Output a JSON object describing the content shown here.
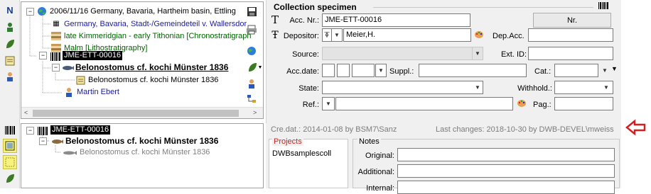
{
  "tree": {
    "root": "2006/11/16 Germany, Bavaria, Hartheim basin, Ettling",
    "locality": "Germany, Bavaria, Stadt-/Gemeindeteil v. Wallersdor",
    "strat1": "late Kimmeridgian - early Tithonian [Chronostratigraph",
    "strat2": "Malm [Lithostratigraphy]",
    "specimen": "JME-ETT-00016",
    "taxon": "Belonostomus cf. kochi Münster 1836",
    "identification": "Belonostomus cf. kochi Münster 1836",
    "collector": "Martin Ebert"
  },
  "tree2": {
    "specimen": "JME-ETT-00016",
    "taxon": "Belonostomus cf. kochi Münster 1836",
    "identification": "Belonostomus cf. kochi Münster 1836"
  },
  "form": {
    "title": "Collection specimen",
    "acc_nr_label": "Acc. Nr.:",
    "acc_nr_value": "JME-ETT-00016",
    "nr_button": "Nr.",
    "depositor_label": "Depositor:",
    "depositor_value": "Meier,H.",
    "dep_acc_label": "Dep.Acc.",
    "source_label": "Source:",
    "ext_id_label": "Ext. ID:",
    "acc_date_label": "Acc.date:",
    "suppl_label": "Suppl.:",
    "cat_label": "Cat.:",
    "state_label": "State:",
    "withhold_label": "Withhold.:",
    "ref_label": "Ref.:",
    "pag_label": "Pag.:"
  },
  "status": {
    "created": "Cre.dat.: 2014-01-08 by BSM7\\Sanz",
    "changes": "Last changes: 2018-10-30 by DWB-DEVEL\\mweiss"
  },
  "projects": {
    "header": "Projects",
    "items": [
      "DWBsamplescoll"
    ]
  },
  "notes": {
    "header": "Notes",
    "original_label": "Original:",
    "additional_label": "Additional:",
    "internal_label": "Internal:"
  },
  "colors": {
    "accent_red": "#d42020",
    "link_blue": "#1a1aa6",
    "strat_green": "#006400",
    "selection": "#000000"
  }
}
